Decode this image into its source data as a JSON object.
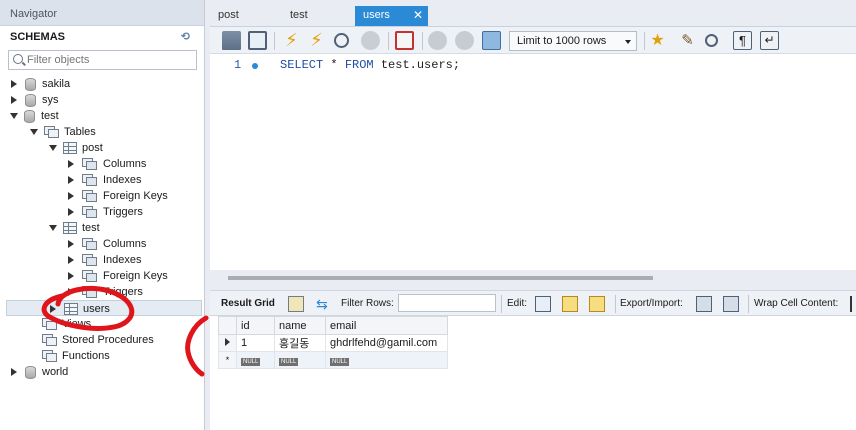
{
  "navigator": {
    "title": "Navigator",
    "schemas_label": "SCHEMAS",
    "filter_placeholder": "Filter objects",
    "tree": {
      "sakila": "sakila",
      "sys": "sys",
      "test": "test",
      "tables": "Tables",
      "post": "post",
      "post_columns": "Columns",
      "post_indexes": "Indexes",
      "post_fk": "Foreign Keys",
      "post_triggers": "Triggers",
      "test_table": "test",
      "test_columns": "Columns",
      "test_indexes": "Indexes",
      "test_fk": "Foreign Keys",
      "test_triggers": "Triggers",
      "users": "users",
      "views": "Views",
      "stored_procedures": "Stored Procedures",
      "functions": "Functions",
      "world": "world"
    }
  },
  "tabs": [
    {
      "label": "post"
    },
    {
      "label": "test"
    },
    {
      "label": "users",
      "active": true
    }
  ],
  "toolbar": {
    "limit_label": "Limit to 1000 rows"
  },
  "editor": {
    "line_number": "1",
    "kw_select": "SELECT",
    "star": " * ",
    "kw_from": "FROM",
    "table_ref": " test.users;"
  },
  "result_toolbar": {
    "result_grid": "Result Grid",
    "filter_rows": "Filter Rows:",
    "edit": "Edit:",
    "export_import": "Export/Import:",
    "wrap_cell": "Wrap Cell Content:"
  },
  "grid": {
    "columns": [
      "id",
      "name",
      "email"
    ],
    "rows": [
      {
        "id": "1",
        "name": "홍길동",
        "email": "ghdrlfehd@gamil.com"
      }
    ],
    "null_label": "NULL",
    "new_row_marker": "*"
  },
  "colors": {
    "accent": "#2a8ad5",
    "annotation": "#e0151b"
  }
}
